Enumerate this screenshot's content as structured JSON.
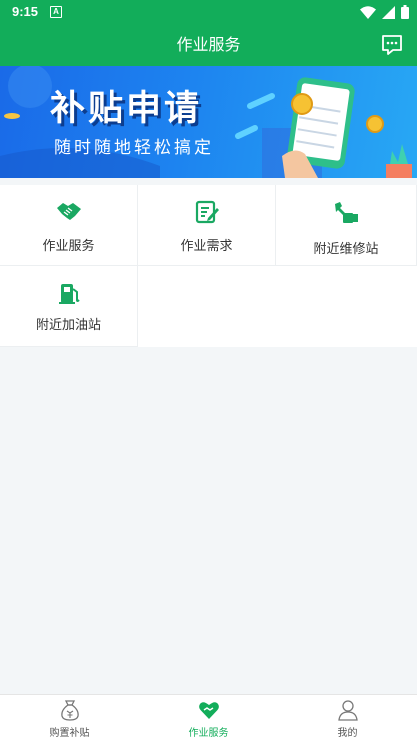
{
  "status_bar": {
    "time": "9:15",
    "notification_badge": "A"
  },
  "header": {
    "title": "作业服务"
  },
  "banner": {
    "title": "补贴申请",
    "subtitle": "随时随地轻松搞定"
  },
  "services": [
    {
      "label": "作业服务",
      "icon": "handshake-icon"
    },
    {
      "label": "作业需求",
      "icon": "edit-note-icon"
    },
    {
      "label": "附近维修站",
      "icon": "repair-tools-icon"
    },
    {
      "label": "附近加油站",
      "icon": "fuel-pump-icon"
    }
  ],
  "bottom_nav": {
    "items": [
      {
        "label": "购置补贴",
        "icon": "money-bag-icon",
        "active": false
      },
      {
        "label": "作业服务",
        "icon": "heart-icon",
        "active": true
      },
      {
        "label": "我的",
        "icon": "user-icon",
        "active": false
      }
    ]
  },
  "colors": {
    "primary": "#12ad5a",
    "banner_blue": "#1d84f0",
    "background": "#f3f6f8"
  }
}
